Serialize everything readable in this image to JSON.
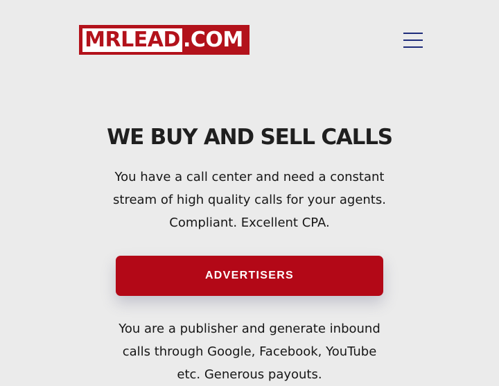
{
  "header": {
    "logo": {
      "left_text": "MRLEAD",
      "right_text": ".COM"
    },
    "menu_icon": "hamburger-menu-icon"
  },
  "hero": {
    "title": "WE BUY AND SELL CALLS",
    "advertiser_text": "You have a call center and need a constant stream of high quality calls for your agents. Compliant. Excellent CPA.",
    "advertisers_button": "ADVERTISERS",
    "publisher_text": "You are a publisher and generate inbound calls through Google, Facebook, YouTube etc. Generous payouts."
  },
  "colors": {
    "brand_red": "#b3121b",
    "button_red": "#b30817",
    "menu_blue": "#1d2b7a",
    "background": "#ebebeb"
  }
}
